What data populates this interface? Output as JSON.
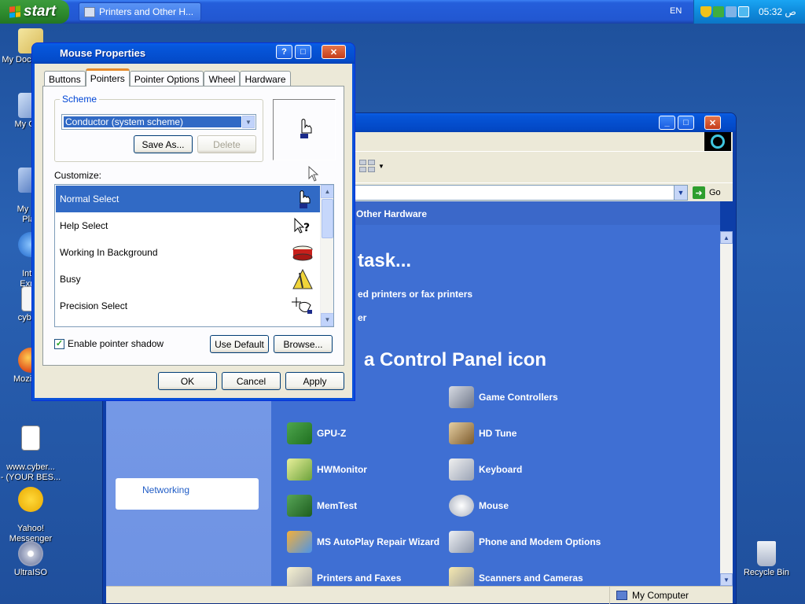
{
  "taskbar": {
    "start_label": "start",
    "task_button": "Printers and Other H...",
    "lang": "EN",
    "clock": "05:32 ص"
  },
  "desktop_icons": [
    {
      "label": "My Documents"
    },
    {
      "label": "My Com"
    },
    {
      "label": "My Net\nPlac"
    },
    {
      "label": "Inter\nExplo"
    },
    {
      "label": "cyberv"
    },
    {
      "label": "Mozilla F"
    },
    {
      "label": "www.cyber...\n- (YOUR BES..."
    },
    {
      "label": "Yahoo!\nMessenger"
    },
    {
      "label": "UltraISO"
    },
    {
      "label": "Recycle Bin"
    }
  ],
  "control_panel": {
    "address_go": "Go",
    "header": "nd Other Hardware",
    "pick_task": "task...",
    "links": [
      "ed printers or fax printers",
      "er"
    ],
    "pick_icon": "a Control Panel icon",
    "network_link": "Networking",
    "icons_left": [
      "GPU-Z",
      "HWMonitor",
      "MemTest",
      "MS AutoPlay Repair Wizard",
      "Printers and Faxes"
    ],
    "icons_right": [
      "Game Controllers",
      "HD Tune",
      "Keyboard",
      "Mouse",
      "Phone and Modem Options",
      "Scanners and Cameras"
    ],
    "status_computer": "My Computer"
  },
  "dialog": {
    "title": "Mouse Properties",
    "tabs": [
      "Buttons",
      "Pointers",
      "Pointer Options",
      "Wheel",
      "Hardware"
    ],
    "active_tab": "Pointers",
    "scheme_label": "Scheme",
    "scheme_value": "Conductor (system scheme)",
    "save_as": "Save As...",
    "delete": "Delete",
    "customize_label": "Customize:",
    "pointers": [
      "Normal Select",
      "Help Select",
      "Working In Background",
      "Busy",
      "Precision Select"
    ],
    "selected_pointer": "Normal Select",
    "shadow_label": "Enable pointer shadow",
    "shadow_checked": true,
    "use_default": "Use Default",
    "browse": "Browse...",
    "ok": "OK",
    "cancel": "Cancel",
    "apply": "Apply"
  }
}
